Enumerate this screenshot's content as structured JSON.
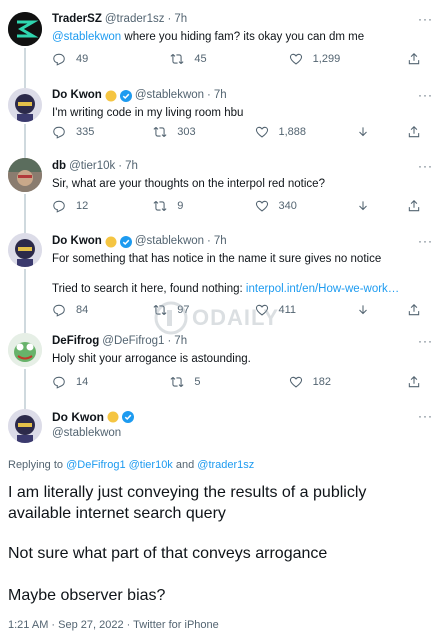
{
  "tweets": [
    {
      "name": "TraderSZ",
      "handle": "@trader1sz",
      "time": "7h",
      "body_link": "@stablekwon",
      "body": " where you hiding fam? its okay you can dm me",
      "replies": "49",
      "retweets": "45",
      "likes": "1,299"
    },
    {
      "name": "Do Kwon",
      "handle": "@stablekwon",
      "time": "7h",
      "body": "I'm writing code in my living room hbu",
      "replies": "335",
      "retweets": "303",
      "likes": "1,888"
    },
    {
      "name": "db",
      "handle": "@tier10k",
      "time": "7h",
      "body": "Sir, what are your thoughts on the interpol red notice?",
      "replies": "12",
      "retweets": "9",
      "likes": "340"
    },
    {
      "name": "Do Kwon",
      "handle": "@stablekwon",
      "time": "7h",
      "body": "For something that has notice in the name it sure gives no notice",
      "body2": "Tried to search it here, found nothing: ",
      "body2_link": "interpol.int/en/How-we-work…",
      "replies": "84",
      "retweets": "97",
      "likes": "411"
    },
    {
      "name": "DeFifrog",
      "handle": "@DeFifrog1",
      "time": "7h",
      "body": "Holy shit your arrogance is astounding.",
      "replies": "14",
      "retweets": "5",
      "likes": "182"
    }
  ],
  "main": {
    "name": "Do Kwon",
    "handle": "@stablekwon",
    "replying_prefix": "Replying to ",
    "replying_to": [
      "@DeFifrog1",
      "@tier10k",
      "@trader1sz"
    ],
    "replying_and": " and ",
    "para1": "I am literally just conveying the results of a publicly available internet search query",
    "para2": "Not sure what part of that conveys arrogance",
    "para3": "Maybe observer bias?",
    "timestamp": "1:21 AM · Sep 27, 2022 · Twitter for iPhone"
  },
  "watermark": "ODAILY",
  "separator": "·",
  "more": "···",
  "colors": {
    "link": "#1d9bf0",
    "muted": "#536471",
    "verified": "#1d9bf0",
    "gold": "#f5c542"
  }
}
